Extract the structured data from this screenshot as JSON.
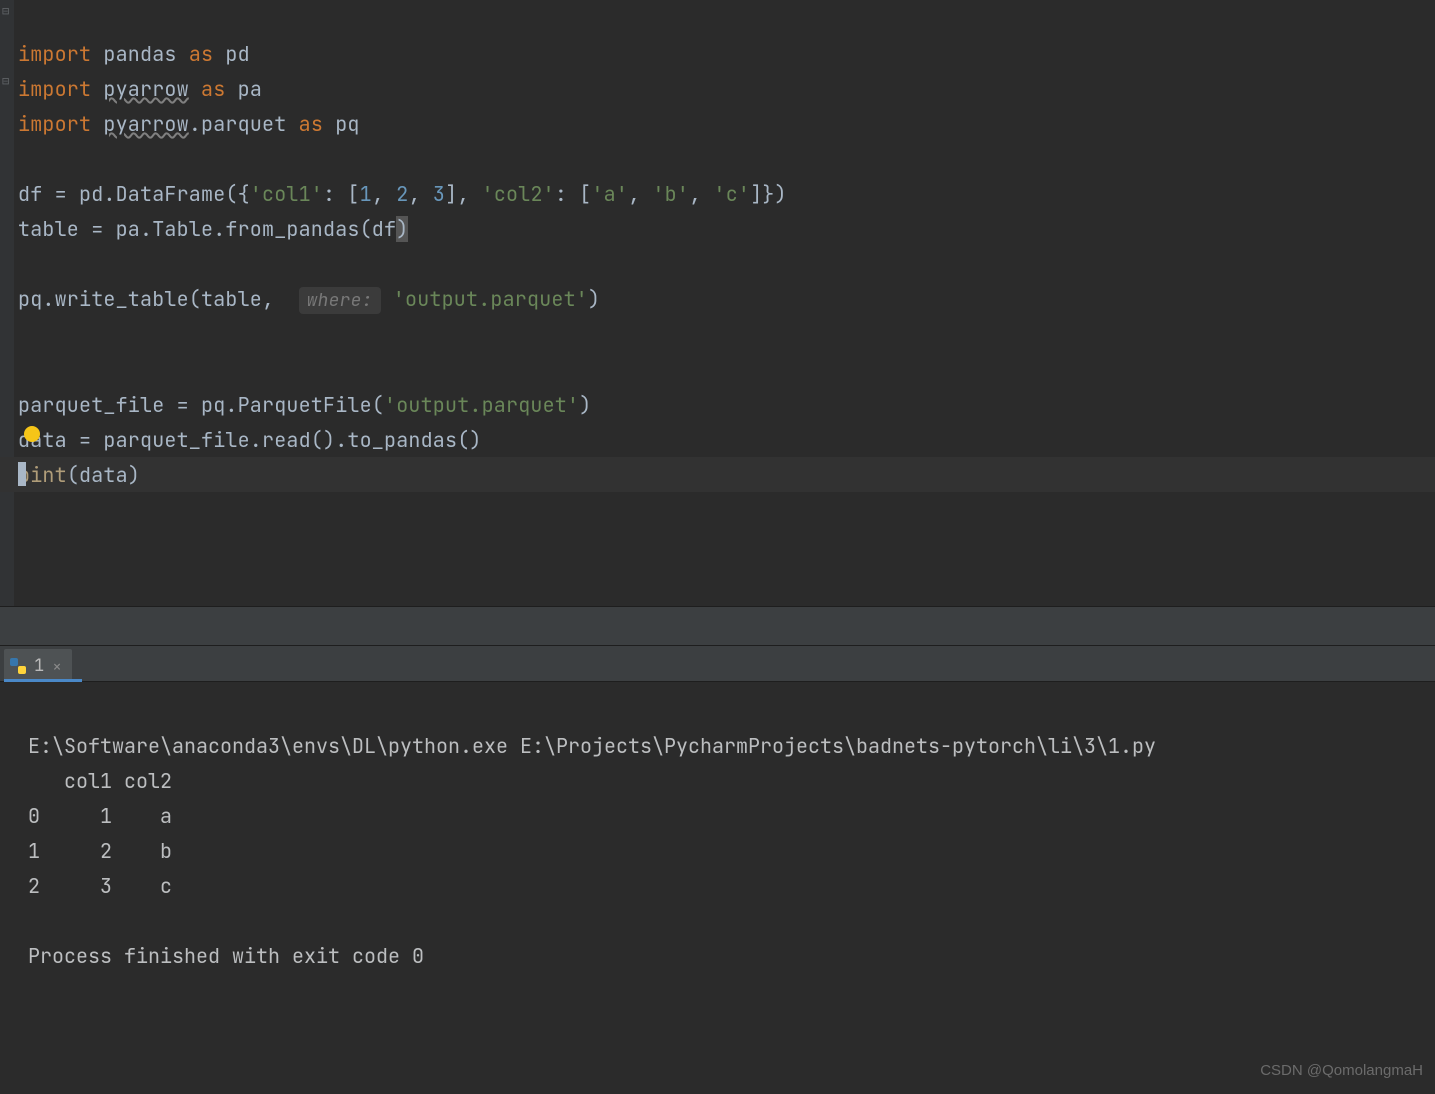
{
  "code": {
    "lines": [
      {
        "type": "import",
        "kw1": "import",
        "mod": "pandas",
        "kw2": "as",
        "alias": "pd"
      },
      {
        "type": "import",
        "kw1": "import",
        "mod": "pyarrow",
        "kw2": "as",
        "alias": "pa",
        "wavy": true
      },
      {
        "type": "import_attr",
        "kw1": "import",
        "mod": "pyarrow",
        "attr": "parquet",
        "kw2": "as",
        "alias": "pq",
        "wavy": true
      },
      {
        "type": "blank"
      },
      {
        "type": "df_assign",
        "text_pre": "df = pd.DataFrame({",
        "s1": "'col1'",
        "mid1": ": [",
        "n1": "1",
        "c1": ", ",
        "n2": "2",
        "c2": ", ",
        "n3": "3",
        "mid2": "], ",
        "s2": "'col2'",
        "mid3": ": [",
        "s3": "'a'",
        "c3": ", ",
        "s4": "'b'",
        "c4": ", ",
        "s5": "'c'",
        "end": "]})"
      },
      {
        "type": "table_assign",
        "pre": "table = pa.Table.from_pandas(df",
        "close": ")"
      },
      {
        "type": "blank"
      },
      {
        "type": "write",
        "pre": "pq.write_table(table, ",
        "hint": "where:",
        "sp": " ",
        "str": "'output.parquet'",
        "end": ")"
      },
      {
        "type": "blank"
      },
      {
        "type": "blank"
      },
      {
        "type": "pfile",
        "pre": "parquet_file = pq.ParquetFile(",
        "str": "'output.parquet'",
        "end": ")"
      },
      {
        "type": "read",
        "text": "data = parquet_file.read().to_pandas()"
      },
      {
        "type": "print",
        "pre": "p",
        "bulb": true,
        "rest": "int",
        "open": "(",
        "arg": "data",
        "close": ")"
      },
      {
        "type": "caret"
      }
    ]
  },
  "tab": {
    "label": "1",
    "close": "×"
  },
  "console": {
    "cmd": "E:\\Software\\anaconda3\\envs\\DL\\python.exe E:\\Projects\\PycharmProjects\\badnets-pytorch\\li\\3\\1.py",
    "header": "   col1 col2",
    "rows": [
      "0     1    a",
      "1     2    b",
      "2     3    c"
    ],
    "exit": "Process finished with exit code 0"
  },
  "watermark": "CSDN @QomolangmaH"
}
